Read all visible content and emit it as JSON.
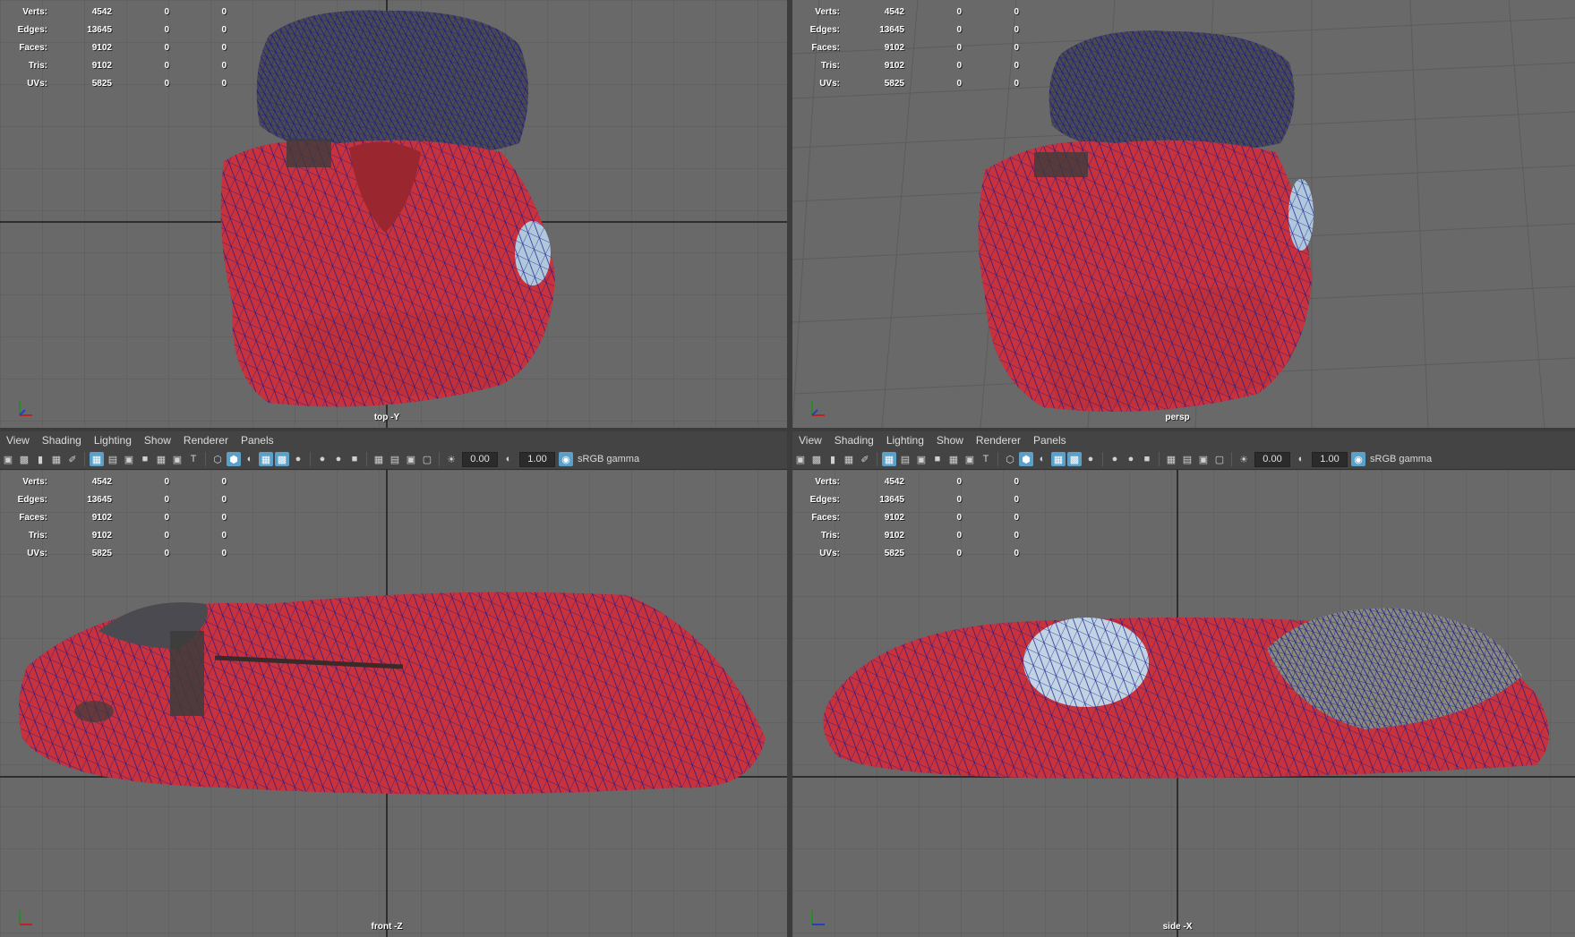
{
  "stats": {
    "labels": [
      "Verts:",
      "Edges:",
      "Faces:",
      "Tris:",
      "UVs:"
    ],
    "values": [
      "4542",
      "13645",
      "9102",
      "9102",
      "5825"
    ],
    "col2": [
      "0",
      "0",
      "0",
      "0",
      "0"
    ],
    "col3": [
      "0",
      "0",
      "0",
      "0",
      "0"
    ]
  },
  "viewports": {
    "top": {
      "camera": "top -Y"
    },
    "persp": {
      "camera": "persp"
    },
    "front": {
      "camera": "front -Z"
    },
    "side": {
      "camera": "side -X"
    }
  },
  "panel_menu": [
    "View",
    "Shading",
    "Lighting",
    "Show",
    "Renderer",
    "Panels"
  ],
  "toolbar": {
    "exposure": "0.00",
    "gamma": "1.00",
    "color_space": "sRGB gamma"
  },
  "colors": {
    "viewport_bg": "#696969",
    "grid": "#5a5a5a",
    "mesh_red": "#c8323c",
    "wire_blue": "#1a1a8c",
    "fur_dark": "#4a4a4a"
  }
}
